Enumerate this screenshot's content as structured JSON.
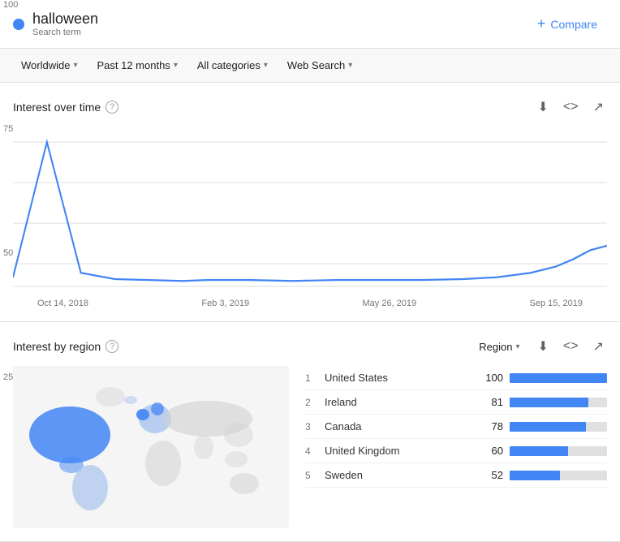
{
  "header": {
    "dot_color": "#4285f4",
    "search_title": "halloween",
    "search_subtitle": "Search term",
    "compare_label": "Compare",
    "compare_plus": "+"
  },
  "filters": {
    "worldwide": "Worldwide",
    "timeframe": "Past 12 months",
    "categories": "All categories",
    "search_type": "Web Search"
  },
  "interest_over_time": {
    "title": "Interest over time",
    "help": "?",
    "y_labels": [
      "100",
      "75",
      "50",
      "25"
    ],
    "x_labels": [
      "Oct 14, 2018",
      "Feb 3, 2019",
      "May 26, 2019",
      "Sep 15, 2019"
    ]
  },
  "interest_by_region": {
    "title": "Interest by region",
    "help": "?",
    "region_label": "Region",
    "regions": [
      {
        "rank": 1,
        "name": "United States",
        "value": 100,
        "bar_pct": 100
      },
      {
        "rank": 2,
        "name": "Ireland",
        "value": 81,
        "bar_pct": 81
      },
      {
        "rank": 3,
        "name": "Canada",
        "value": 78,
        "bar_pct": 78
      },
      {
        "rank": 4,
        "name": "United Kingdom",
        "value": 60,
        "bar_pct": 60
      },
      {
        "rank": 5,
        "name": "Sweden",
        "value": 52,
        "bar_pct": 52
      }
    ]
  },
  "icons": {
    "download": "⬇",
    "code": "<>",
    "share": "↗",
    "chevron": "▾"
  }
}
